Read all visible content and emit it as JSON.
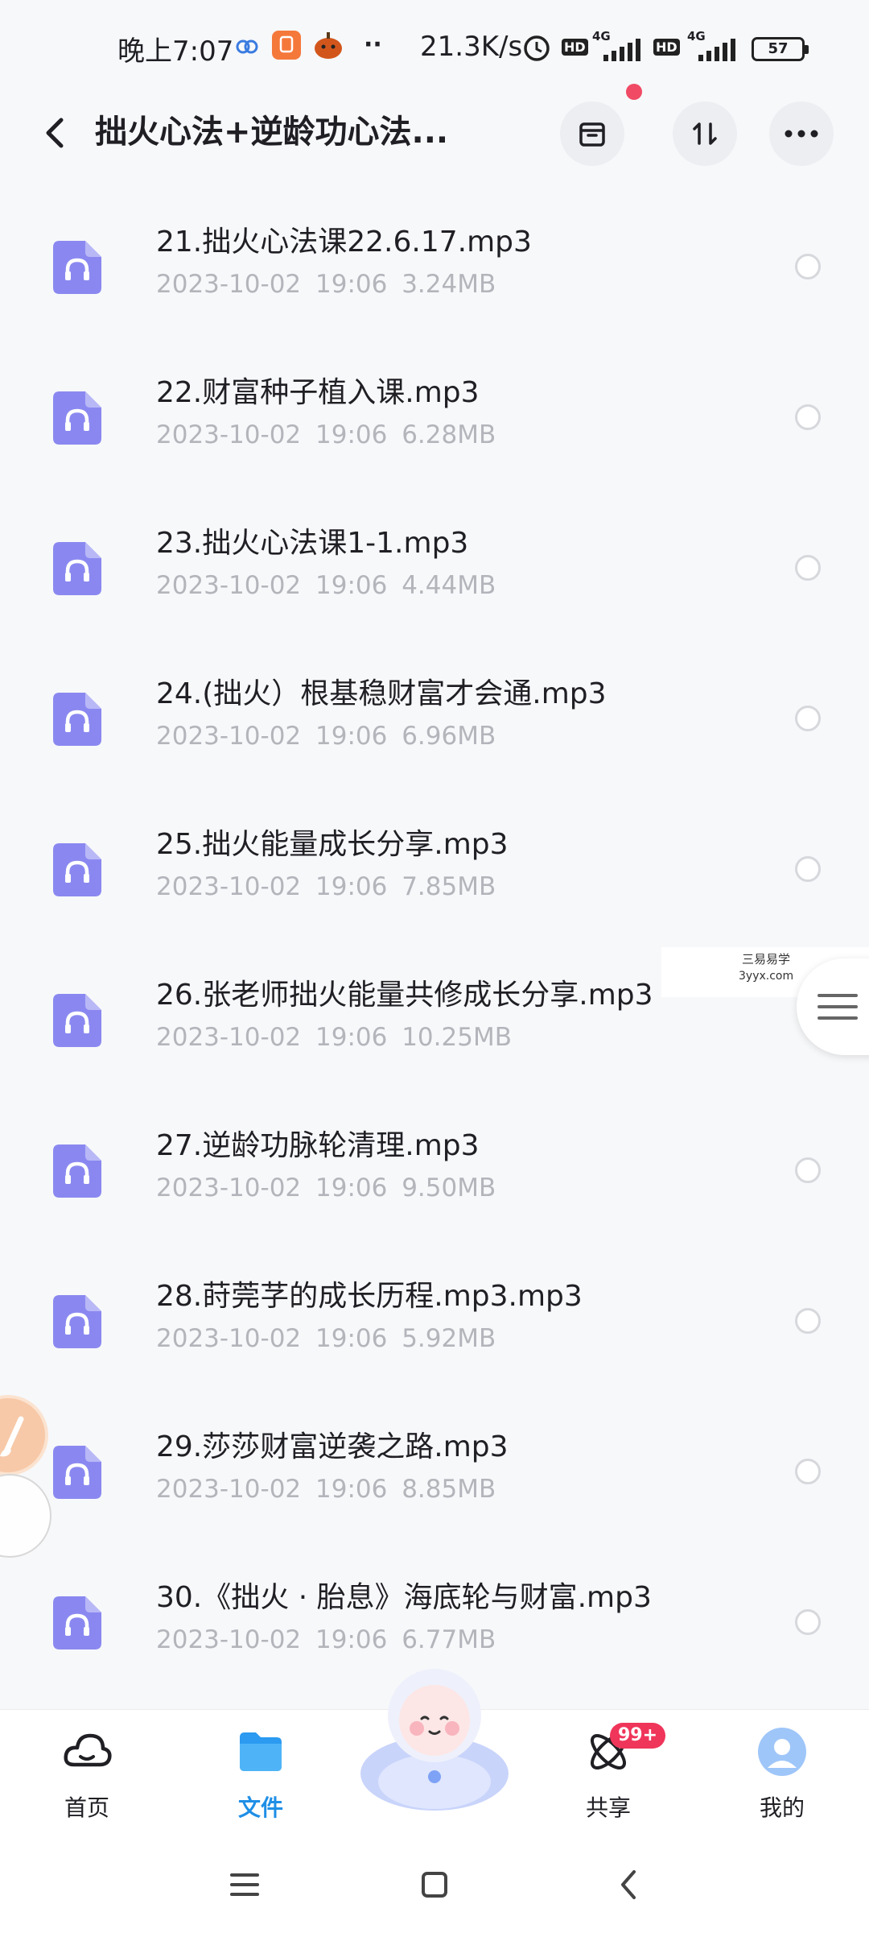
{
  "status_bar": {
    "time": "晚上7:07",
    "net_speed": "21.3K/s",
    "sim1_label": "HD",
    "sim1_net": "4G",
    "sim2_label": "HD",
    "sim2_net": "4G",
    "battery": "57",
    "icons": [
      "cloud-icon",
      "app-notification-icon",
      "pumpkin-icon",
      "more-dots-icon",
      "alarm-icon",
      "signal-icon",
      "signal-icon",
      "battery-icon"
    ]
  },
  "header": {
    "title": "拙火心法+逆龄功心法...",
    "icons": [
      "back-icon",
      "archive-icon",
      "sort-icon",
      "more-icon"
    ],
    "dot_color": "#f04a64"
  },
  "files": [
    {
      "name": "21.拙火心法课22.6.17.mp3",
      "meta": "2023-10-02 19:06 3.24MB"
    },
    {
      "name": "22.财富种子植入课.mp3",
      "meta": "2023-10-02 19:06 6.28MB"
    },
    {
      "name": "23.拙火心法课1-1.mp3",
      "meta": "2023-10-02 19:06 4.44MB"
    },
    {
      "name": "24.(拙火）根基稳财富才会通.mp3",
      "meta": "2023-10-02 19:06 6.96MB"
    },
    {
      "name": "25.拙火能量成长分享.mp3",
      "meta": "2023-10-02 19:06 7.85MB"
    },
    {
      "name": "26.张老师拙火能量共修成长分享.mp3",
      "meta": "2023-10-02 19:06 10.25MB"
    },
    {
      "name": "27.逆龄功脉轮清理.mp3",
      "meta": "2023-10-02 19:06 9.50MB"
    },
    {
      "name": "28.莳莞芓的成长历程.mp3.mp3",
      "meta": "2023-10-02 19:06 5.92MB"
    },
    {
      "name": "29.莎莎财富逆袭之路.mp3",
      "meta": "2023-10-02 19:06 8.85MB"
    },
    {
      "name": "30.《拙火 · 胎息》海底轮与财富.mp3",
      "meta": "2023-10-02 19:06 6.77MB"
    }
  ],
  "watermark": {
    "line1": "三易易学",
    "line2": "3yyx.com"
  },
  "bottom_nav": {
    "items": [
      {
        "label": "首页",
        "icon": "cloud-home-icon"
      },
      {
        "label": "文件",
        "icon": "folder-icon"
      },
      {
        "label": "共享",
        "icon": "share-atom-icon"
      },
      {
        "label": "我的",
        "icon": "avatar-icon"
      }
    ],
    "share_badge": "99+",
    "active_color": "#1f8fe6"
  },
  "system_nav": {
    "icons": [
      "menu-icon",
      "home-square-icon",
      "back-chevron-icon"
    ]
  },
  "colors": {
    "file_icon": "#8a88f0",
    "badge": "#f0355a"
  }
}
